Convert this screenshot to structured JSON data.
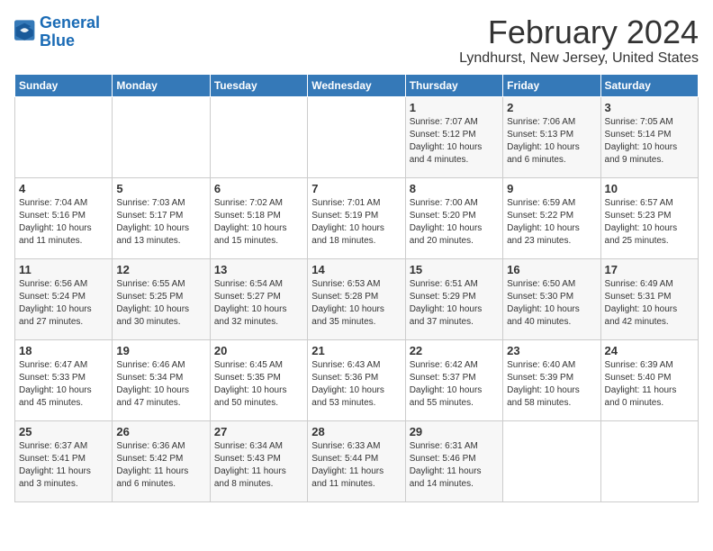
{
  "header": {
    "logo_line1": "General",
    "logo_line2": "Blue",
    "month_year": "February 2024",
    "location": "Lyndhurst, New Jersey, United States"
  },
  "days_of_week": [
    "Sunday",
    "Monday",
    "Tuesday",
    "Wednesday",
    "Thursday",
    "Friday",
    "Saturday"
  ],
  "weeks": [
    [
      {
        "day": "",
        "detail": ""
      },
      {
        "day": "",
        "detail": ""
      },
      {
        "day": "",
        "detail": ""
      },
      {
        "day": "",
        "detail": ""
      },
      {
        "day": "1",
        "detail": "Sunrise: 7:07 AM\nSunset: 5:12 PM\nDaylight: 10 hours\nand 4 minutes."
      },
      {
        "day": "2",
        "detail": "Sunrise: 7:06 AM\nSunset: 5:13 PM\nDaylight: 10 hours\nand 6 minutes."
      },
      {
        "day": "3",
        "detail": "Sunrise: 7:05 AM\nSunset: 5:14 PM\nDaylight: 10 hours\nand 9 minutes."
      }
    ],
    [
      {
        "day": "4",
        "detail": "Sunrise: 7:04 AM\nSunset: 5:16 PM\nDaylight: 10 hours\nand 11 minutes."
      },
      {
        "day": "5",
        "detail": "Sunrise: 7:03 AM\nSunset: 5:17 PM\nDaylight: 10 hours\nand 13 minutes."
      },
      {
        "day": "6",
        "detail": "Sunrise: 7:02 AM\nSunset: 5:18 PM\nDaylight: 10 hours\nand 15 minutes."
      },
      {
        "day": "7",
        "detail": "Sunrise: 7:01 AM\nSunset: 5:19 PM\nDaylight: 10 hours\nand 18 minutes."
      },
      {
        "day": "8",
        "detail": "Sunrise: 7:00 AM\nSunset: 5:20 PM\nDaylight: 10 hours\nand 20 minutes."
      },
      {
        "day": "9",
        "detail": "Sunrise: 6:59 AM\nSunset: 5:22 PM\nDaylight: 10 hours\nand 23 minutes."
      },
      {
        "day": "10",
        "detail": "Sunrise: 6:57 AM\nSunset: 5:23 PM\nDaylight: 10 hours\nand 25 minutes."
      }
    ],
    [
      {
        "day": "11",
        "detail": "Sunrise: 6:56 AM\nSunset: 5:24 PM\nDaylight: 10 hours\nand 27 minutes."
      },
      {
        "day": "12",
        "detail": "Sunrise: 6:55 AM\nSunset: 5:25 PM\nDaylight: 10 hours\nand 30 minutes."
      },
      {
        "day": "13",
        "detail": "Sunrise: 6:54 AM\nSunset: 5:27 PM\nDaylight: 10 hours\nand 32 minutes."
      },
      {
        "day": "14",
        "detail": "Sunrise: 6:53 AM\nSunset: 5:28 PM\nDaylight: 10 hours\nand 35 minutes."
      },
      {
        "day": "15",
        "detail": "Sunrise: 6:51 AM\nSunset: 5:29 PM\nDaylight: 10 hours\nand 37 minutes."
      },
      {
        "day": "16",
        "detail": "Sunrise: 6:50 AM\nSunset: 5:30 PM\nDaylight: 10 hours\nand 40 minutes."
      },
      {
        "day": "17",
        "detail": "Sunrise: 6:49 AM\nSunset: 5:31 PM\nDaylight: 10 hours\nand 42 minutes."
      }
    ],
    [
      {
        "day": "18",
        "detail": "Sunrise: 6:47 AM\nSunset: 5:33 PM\nDaylight: 10 hours\nand 45 minutes."
      },
      {
        "day": "19",
        "detail": "Sunrise: 6:46 AM\nSunset: 5:34 PM\nDaylight: 10 hours\nand 47 minutes."
      },
      {
        "day": "20",
        "detail": "Sunrise: 6:45 AM\nSunset: 5:35 PM\nDaylight: 10 hours\nand 50 minutes."
      },
      {
        "day": "21",
        "detail": "Sunrise: 6:43 AM\nSunset: 5:36 PM\nDaylight: 10 hours\nand 53 minutes."
      },
      {
        "day": "22",
        "detail": "Sunrise: 6:42 AM\nSunset: 5:37 PM\nDaylight: 10 hours\nand 55 minutes."
      },
      {
        "day": "23",
        "detail": "Sunrise: 6:40 AM\nSunset: 5:39 PM\nDaylight: 10 hours\nand 58 minutes."
      },
      {
        "day": "24",
        "detail": "Sunrise: 6:39 AM\nSunset: 5:40 PM\nDaylight: 11 hours\nand 0 minutes."
      }
    ],
    [
      {
        "day": "25",
        "detail": "Sunrise: 6:37 AM\nSunset: 5:41 PM\nDaylight: 11 hours\nand 3 minutes."
      },
      {
        "day": "26",
        "detail": "Sunrise: 6:36 AM\nSunset: 5:42 PM\nDaylight: 11 hours\nand 6 minutes."
      },
      {
        "day": "27",
        "detail": "Sunrise: 6:34 AM\nSunset: 5:43 PM\nDaylight: 11 hours\nand 8 minutes."
      },
      {
        "day": "28",
        "detail": "Sunrise: 6:33 AM\nSunset: 5:44 PM\nDaylight: 11 hours\nand 11 minutes."
      },
      {
        "day": "29",
        "detail": "Sunrise: 6:31 AM\nSunset: 5:46 PM\nDaylight: 11 hours\nand 14 minutes."
      },
      {
        "day": "",
        "detail": ""
      },
      {
        "day": "",
        "detail": ""
      }
    ]
  ]
}
